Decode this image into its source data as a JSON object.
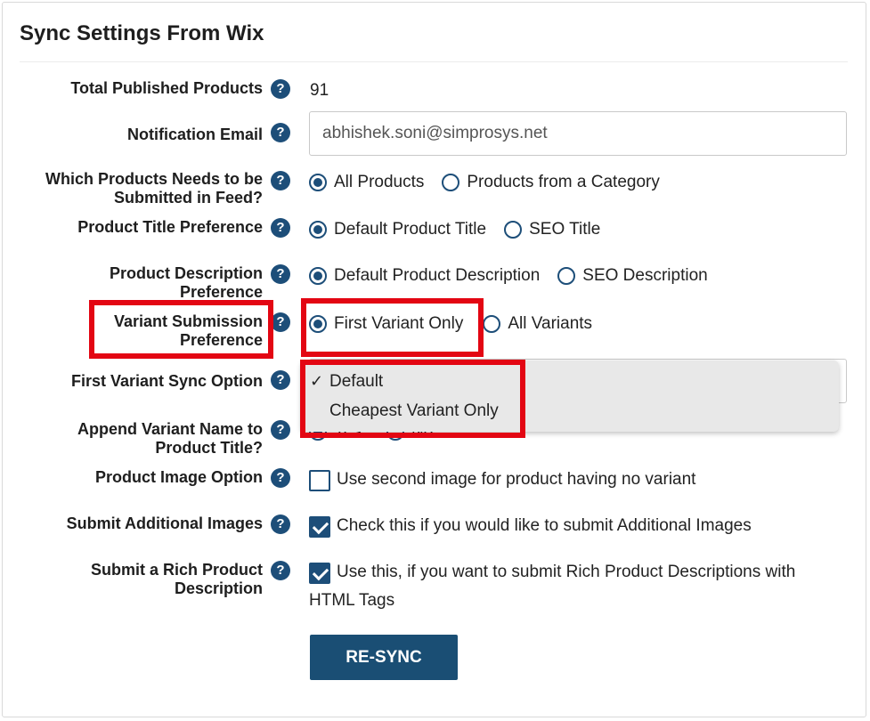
{
  "title": "Sync Settings From Wix",
  "rows": {
    "total_products": {
      "label": "Total Published Products",
      "value": "91"
    },
    "notification_email": {
      "label": "Notification Email",
      "value": "abhishek.soni@simprosys.net"
    },
    "products_in_feed": {
      "label_line1": "Which Products Needs to be",
      "label_line2": "Submitted in Feed?",
      "options": [
        "All Products",
        "Products from a Category"
      ],
      "selected": "All Products"
    },
    "title_pref": {
      "label": "Product Title Preference",
      "options": [
        "Default Product Title",
        "SEO Title"
      ],
      "selected": "Default Product Title"
    },
    "desc_pref": {
      "label_line1": "Product Description",
      "label_line2": "Preference",
      "options": [
        "Default Product Description",
        "SEO Description"
      ],
      "selected": "Default Product Description"
    },
    "variant_pref": {
      "label_line1": "Variant Submission",
      "label_line2": "Preference",
      "options": [
        "First Variant Only",
        "All Variants"
      ],
      "selected": "First Variant Only"
    },
    "first_variant_sync": {
      "label": "First Variant Sync Option",
      "dropdown_options": [
        "Default",
        "Cheapest Variant Only"
      ],
      "selected": "Default",
      "check_glyph": "✓"
    },
    "append_variant": {
      "label_line1": "Append Variant Name to",
      "label_line2": "Product Title?",
      "partial_opt1": "Yes",
      "partial_opt2": "No"
    },
    "image_option": {
      "label": "Product Image Option",
      "check_label": "Use second image for product having no variant",
      "checked": false
    },
    "additional_images": {
      "label": "Submit Additional Images",
      "check_label": "Check this if you would like to submit Additional Images",
      "checked": true
    },
    "rich_desc": {
      "label_line1": "Submit a Rich Product",
      "label_line2": "Description",
      "check_label_line1": "Use this, if you want to submit Rich Product Descriptions with",
      "check_label_line2": "HTML Tags",
      "checked": true
    }
  },
  "help_glyph": "?",
  "resync_label": "RE-SYNC",
  "colors": {
    "primary": "#1d4e79",
    "highlight": "#e30613",
    "button": "#1a4e74"
  }
}
